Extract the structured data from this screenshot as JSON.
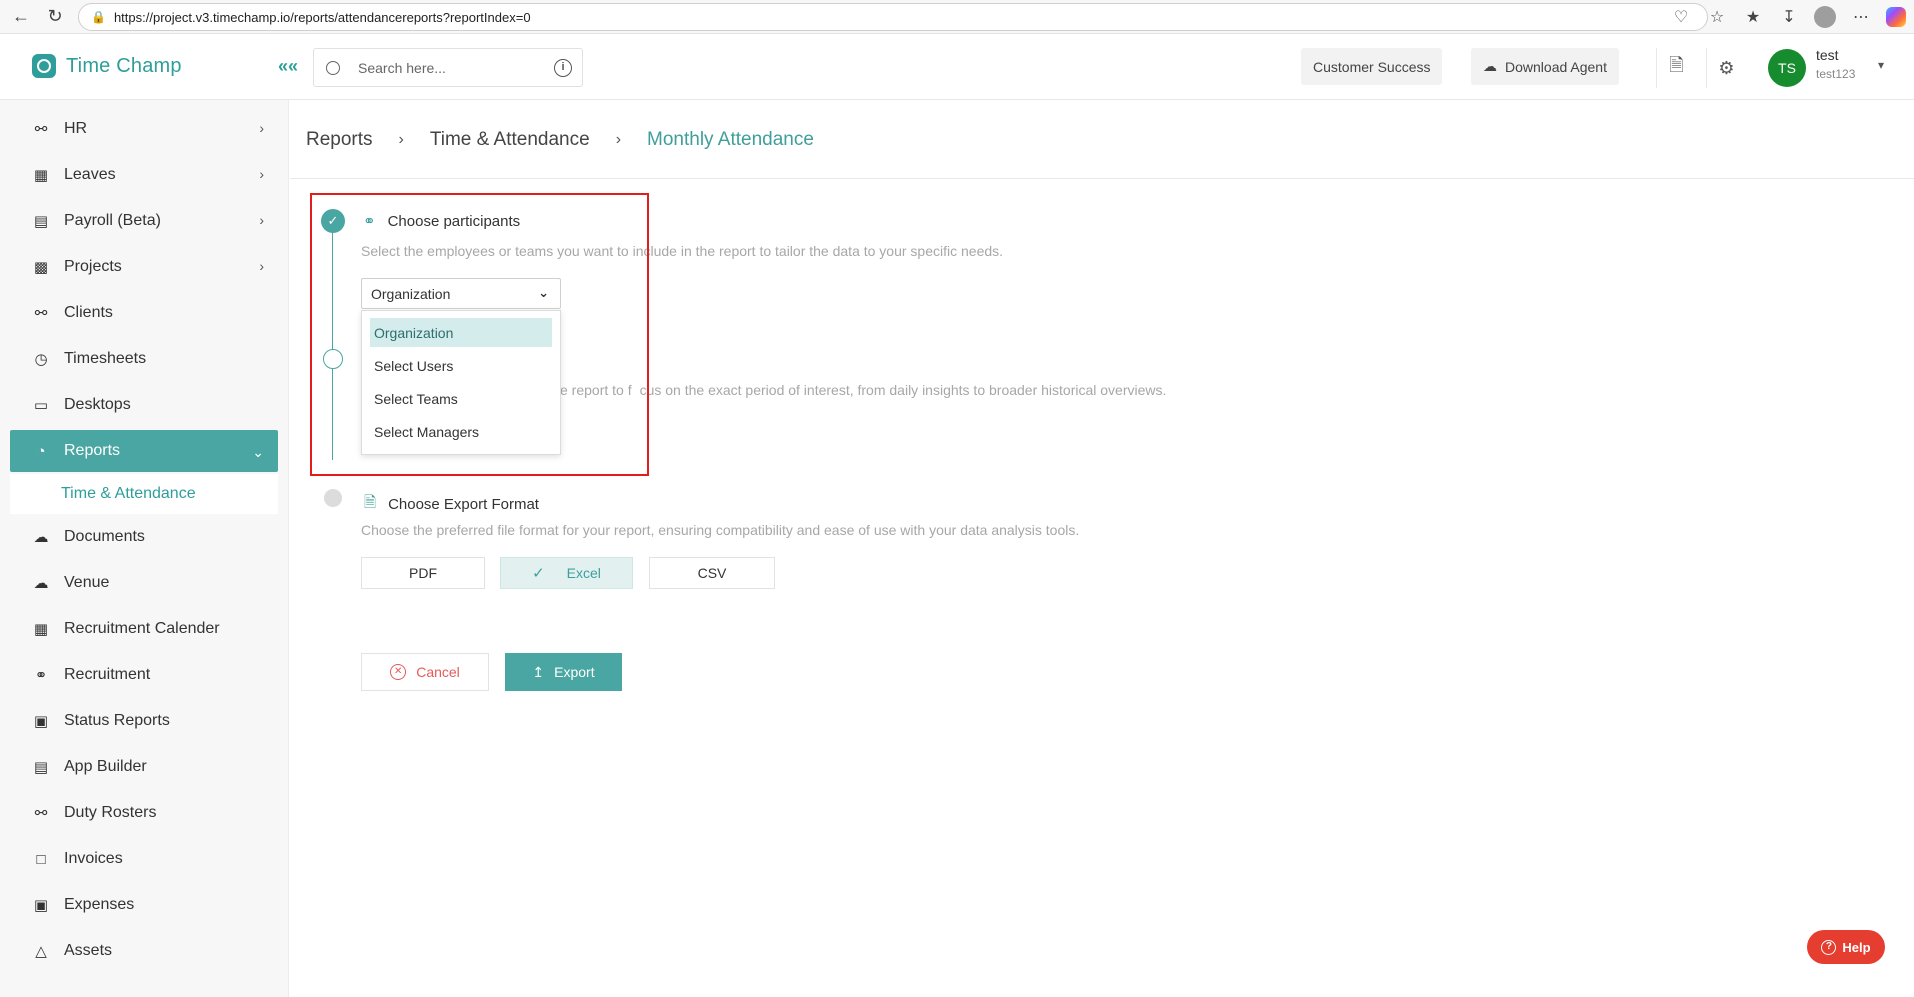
{
  "browser": {
    "url": "https://project.v3.timechamp.io/reports/attendancereports?reportIndex=0"
  },
  "header": {
    "logo_text": "Time Champ",
    "search_placeholder": "Search here...",
    "customer_success": "Customer Success",
    "download_agent": "Download Agent",
    "user_initials": "TS",
    "user_name": "test",
    "user_sub": "test123"
  },
  "sidebar": {
    "items": [
      {
        "label": "HR"
      },
      {
        "label": "Leaves"
      },
      {
        "label": "Payroll (Beta)"
      },
      {
        "label": "Projects"
      },
      {
        "label": "Clients"
      },
      {
        "label": "Timesheets"
      },
      {
        "label": "Desktops"
      },
      {
        "label": "Reports"
      },
      {
        "label": "Documents"
      },
      {
        "label": "Venue"
      },
      {
        "label": "Recruitment Calender"
      },
      {
        "label": "Recruitment"
      },
      {
        "label": "Status Reports"
      },
      {
        "label": "App Builder"
      },
      {
        "label": "Duty Rosters"
      },
      {
        "label": "Invoices"
      },
      {
        "label": "Expenses"
      },
      {
        "label": "Assets"
      }
    ],
    "sub_item": "Time & Attendance"
  },
  "breadcrumb": {
    "items": [
      "Reports",
      "Time & Attendance",
      "Monthly Attendance"
    ]
  },
  "steps": {
    "participants": {
      "title": "Choose participants",
      "desc_a": "Select the employees or teams you want",
      "desc_b": "to include in the report to tailor the data to your specific needs."
    },
    "date": {
      "desc_partial_a": "e report to f",
      "desc_partial_b": "cus on the exact period of interest, from daily insights to broader historical overviews."
    },
    "export": {
      "title": "Choose Export Format",
      "desc": "Choose the preferred file format for your report, ensuring compatibility and ease of use with your data analysis tools."
    }
  },
  "participants_select": {
    "value": "Organization",
    "options": [
      "Organization",
      "Select Users",
      "Select Teams",
      "Select Managers"
    ]
  },
  "formats": [
    "PDF",
    "Excel",
    "CSV"
  ],
  "actions": {
    "cancel": "Cancel",
    "export": "Export"
  },
  "help": "Help",
  "colors": {
    "accent": "#4aa6a3",
    "highlight": "#e31c1c",
    "help": "#e53e30"
  }
}
